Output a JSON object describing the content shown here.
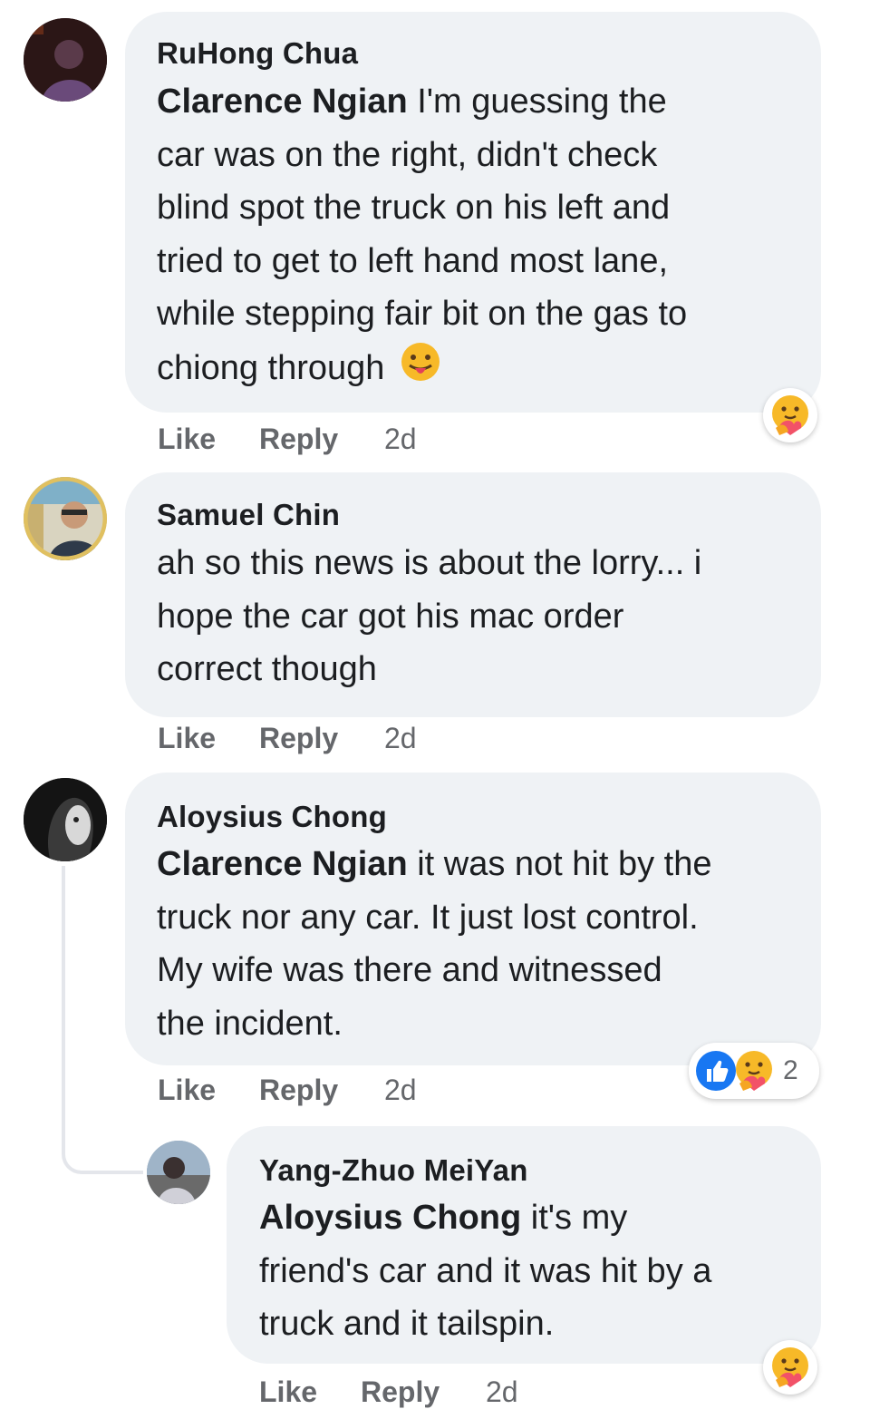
{
  "comments": [
    {
      "author": "RuHong Chua",
      "mention": "Clarence Ngian",
      "lines": [
        " I'm guessing the",
        "car was on the right, didn't check",
        "blind spot the truck on his left and",
        "tried to get to left hand most lane,",
        "while stepping fair bit on the gas to",
        "chiong through "
      ],
      "emoji": "tongue-out-emoji",
      "like": "Like",
      "reply": "Reply",
      "time": "2d",
      "reactions": [
        "care"
      ]
    },
    {
      "author": "Samuel Chin",
      "lines": [
        "ah so this news is about the lorry... i",
        "hope the car got his mac order",
        "correct though"
      ],
      "like": "Like",
      "reply": "Reply",
      "time": "2d"
    },
    {
      "author": "Aloysius Chong",
      "mention": "Clarence Ngian",
      "lines": [
        " it was not hit by the",
        "truck nor any car. It just lost control.",
        "My wife was there and witnessed",
        "the incident."
      ],
      "like": "Like",
      "reply": "Reply",
      "time": "2d",
      "reactions": [
        "like",
        "care"
      ],
      "reaction_count": "2"
    },
    {
      "author": "Yang-Zhuo MeiYan",
      "mention": "Aloysius Chong",
      "lines": [
        " it's my",
        "friend's car and it was hit by a",
        "truck and it tailspin."
      ],
      "like": "Like",
      "reply": "Reply",
      "time": "2d",
      "reactions": [
        "care"
      ]
    }
  ],
  "colors": {
    "bubble": "#eff2f5",
    "secondary_text": "#65676b",
    "like_blue": "#1877f2",
    "care_yellow": "#f7b928"
  }
}
